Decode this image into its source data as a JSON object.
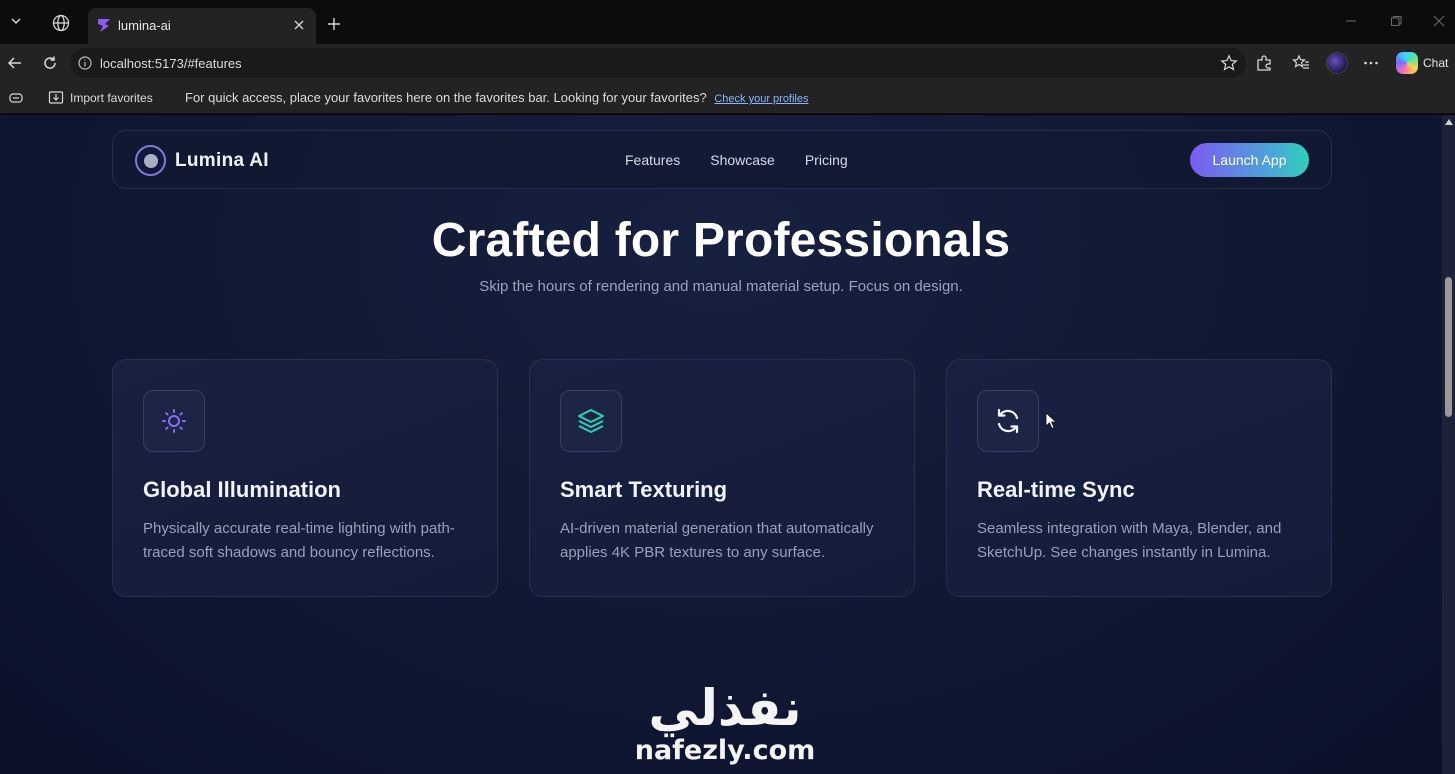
{
  "browser": {
    "tab_title": "lumina-ai",
    "url": "localhost:5173/#features",
    "chat_label": "Chat",
    "favorites_bar": {
      "import_label": "Import favorites",
      "message": "For quick access, place your favorites here on the favorites bar. Looking for your favorites?",
      "link": "Check your profiles"
    },
    "icons": [
      "tab-list-icon",
      "globe-icon",
      "tab-favicon-icon",
      "close-icon",
      "plus-icon",
      "minimize-icon",
      "restore-icon",
      "window-close-icon",
      "back-icon",
      "refresh-icon",
      "info-icon",
      "star-icon",
      "extensions-icon",
      "favorites-icon",
      "more-icon",
      "copilot-icon",
      "reading-view-icon",
      "import-icon"
    ]
  },
  "site": {
    "brand": "Lumina AI",
    "nav": {
      "features": "Features",
      "showcase": "Showcase",
      "pricing": "Pricing"
    },
    "cta": "Launch App",
    "hero": {
      "title": "Crafted for Professionals",
      "subtitle": "Skip the hours of rendering and manual material setup. Focus on design."
    },
    "features": [
      {
        "icon": "sun-icon",
        "title": "Global Illumination",
        "text": "Physically accurate real-time lighting with path-traced soft shadows and bouncy reflections."
      },
      {
        "icon": "layers-icon",
        "title": "Smart Texturing",
        "text": "AI-driven material generation that automatically applies 4K PBR textures to any surface."
      },
      {
        "icon": "sync-icon",
        "title": "Real-time Sync",
        "text": "Seamless integration with Maya, Blender, and SketchUp. See changes instantly in Lumina."
      }
    ],
    "colors": {
      "accent_purple": "#7b5cf0",
      "accent_teal": "#2ed0b8",
      "sun_icon": "#8b6cf2",
      "layers_icon": "#2fd1b6",
      "background": "#121a35"
    }
  },
  "watermark": {
    "arabic": "نفذلي",
    "latin": "nafezly.com"
  }
}
